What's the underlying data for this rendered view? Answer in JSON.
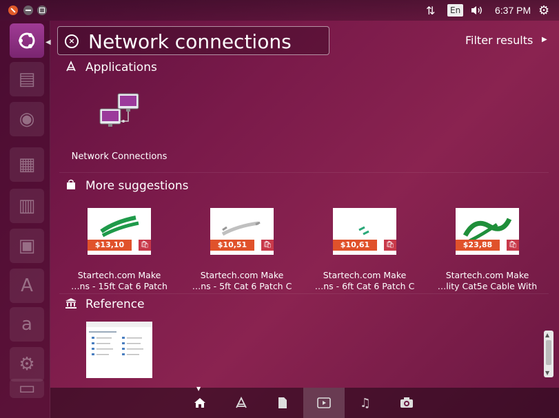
{
  "panel": {
    "language": "En",
    "time": "6:37 PM"
  },
  "search": {
    "query": "Network connections",
    "filter_label": "Filter results"
  },
  "sections": {
    "applications": {
      "title": "Applications",
      "apps": [
        {
          "label": "Network Connections",
          "icon": "network-connections-icon"
        }
      ]
    },
    "suggestions": {
      "title": "More suggestions",
      "items": [
        {
          "price": "$13,10",
          "title_line1": "Startech.com Make",
          "title_line2": "…ns - 15ft Cat 6 Patch",
          "cable_color": "#1f9a4a"
        },
        {
          "price": "$10,51",
          "title_line1": "Startech.com Make",
          "title_line2": "…ns - 5ft Cat 6 Patch C",
          "cable_color": "#c0c0c0"
        },
        {
          "price": "$10,61",
          "title_line1": "Startech.com Make",
          "title_line2": "…ns - 6ft Cat 6 Patch C",
          "cable_color": "#2aa879"
        },
        {
          "price": "$23,88",
          "title_line1": "Startech.com Make",
          "title_line2": "…lity Cat5e Cable With",
          "cable_color": "#1f8f3a"
        }
      ]
    },
    "reference": {
      "title": "Reference"
    }
  },
  "lenses": [
    {
      "name": "home",
      "icon": "home-icon"
    },
    {
      "name": "applications",
      "icon": "applications-icon"
    },
    {
      "name": "files",
      "icon": "files-icon"
    },
    {
      "name": "video",
      "icon": "video-icon"
    },
    {
      "name": "music",
      "icon": "music-icon"
    },
    {
      "name": "photos",
      "icon": "photos-icon"
    }
  ],
  "colors": {
    "accent": "#e0522b",
    "launcher_active": "#a03b95"
  }
}
